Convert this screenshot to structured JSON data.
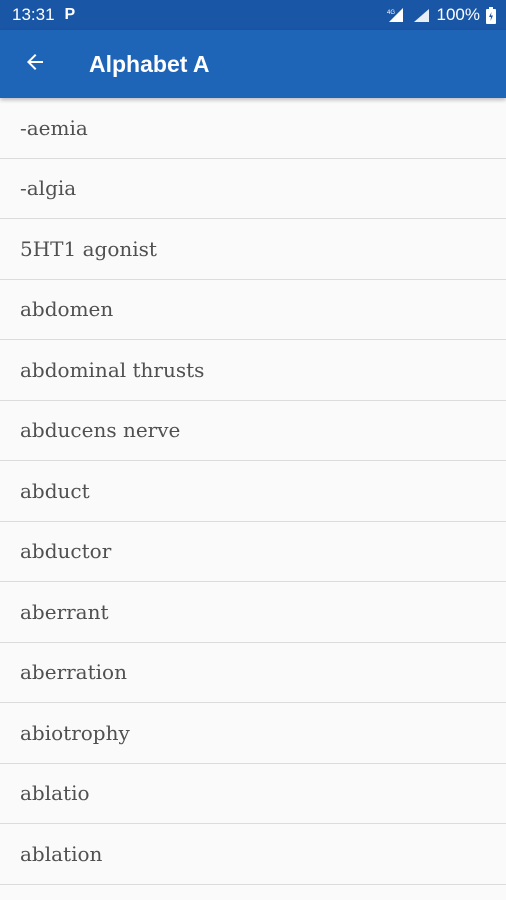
{
  "status_bar": {
    "time": "13:31",
    "notification_icon": "P",
    "battery_percent": "100%"
  },
  "app_bar": {
    "title": "Alphabet A",
    "back_icon": "arrow-left-icon"
  },
  "terms": [
    "-aemia",
    "-algia",
    "5HT1 agonist",
    "abdomen",
    "abdominal thrusts",
    "abducens nerve",
    "abduct",
    "abductor",
    "aberrant",
    "aberration",
    "abiotrophy",
    "ablatio",
    "ablation"
  ],
  "colors": {
    "status_bar": "#1a56a6",
    "app_bar": "#1f65b7",
    "background": "#fafafa",
    "divider": "#dcdcdc",
    "text": "#505050"
  }
}
